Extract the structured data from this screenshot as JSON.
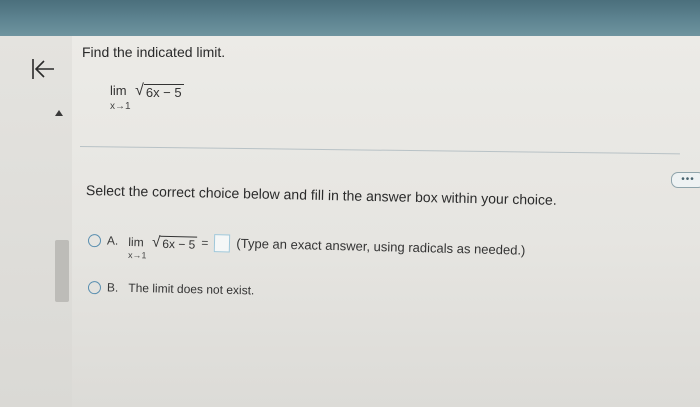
{
  "question": {
    "prompt": "Find the indicated limit.",
    "lim_word": "lim",
    "radical_symbol": "√",
    "expression": "6x − 5",
    "subscript": "x→1"
  },
  "instruction": "Select the correct choice below and fill in the answer box within your choice.",
  "choices": [
    {
      "letter": "A.",
      "lim_word": "lim",
      "expression": "6x − 5",
      "subscript": "x→1",
      "equals": "=",
      "answer_value": "",
      "hint": "(Type an exact answer, using radicals as needed.)"
    },
    {
      "letter": "B.",
      "text": "The limit does not exist."
    }
  ],
  "toolbar": {
    "more_label": "•••"
  },
  "icons": {
    "back": "back-to-start-icon",
    "collapse": "caret-up-icon"
  },
  "colors": {
    "topbar": "#5e8491",
    "radio_border": "#5a8fb0",
    "answer_box_border": "#9fc7d9"
  }
}
